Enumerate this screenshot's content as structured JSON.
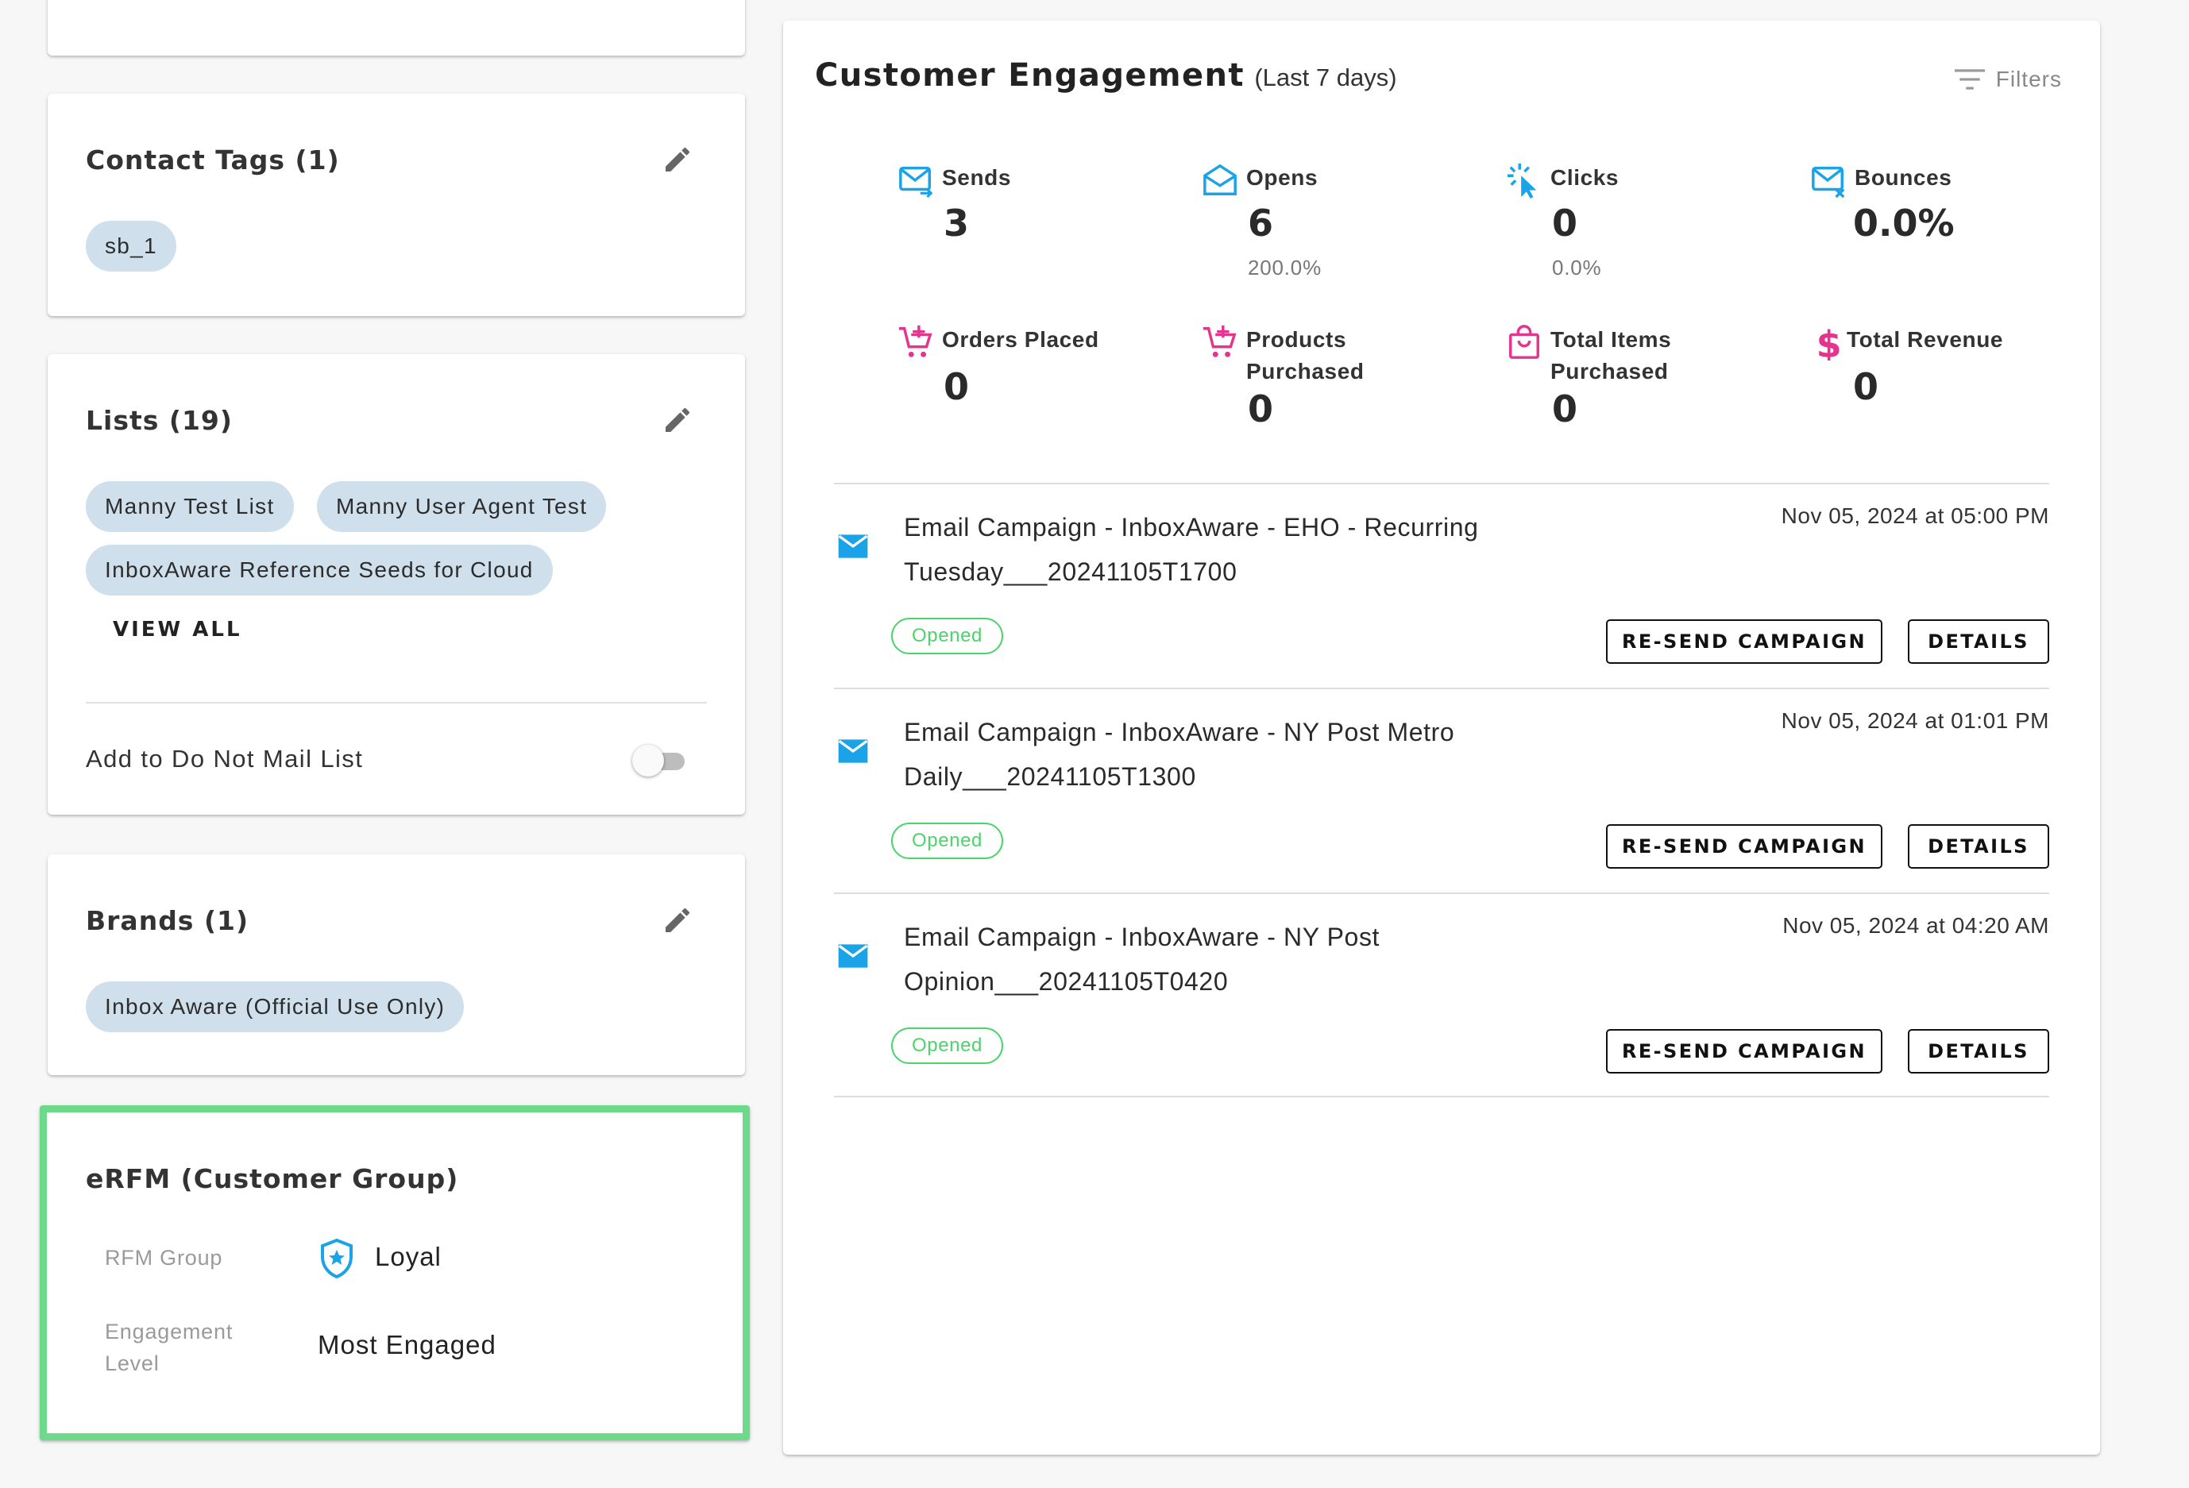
{
  "contact_tags": {
    "title": "Contact Tags (1)",
    "tags": [
      "sb_1"
    ]
  },
  "lists": {
    "title": "Lists (19)",
    "chips": [
      "Manny Test List",
      "Manny User Agent Test",
      "InboxAware Reference Seeds for Cloud"
    ],
    "view_all": "VIEW ALL",
    "do_not_mail_label": "Add to Do Not Mail List",
    "do_not_mail_on": false
  },
  "brands": {
    "title": "Brands (1)",
    "chips": [
      "Inbox Aware (Official Use Only)"
    ]
  },
  "erfm": {
    "title": "eRFM (Customer Group)",
    "rfm_group_label": "RFM Group",
    "rfm_group_value": "Loyal",
    "engagement_label": "Engagement Level",
    "engagement_value": "Most Engaged",
    "highlight_color": "#6dd98a"
  },
  "engagement": {
    "title": "Customer Engagement",
    "period": "(Last 7 days)",
    "filters_label": "Filters",
    "metrics": [
      {
        "label": "Sends",
        "value": "3",
        "pct": "",
        "icon": "mail-send-icon"
      },
      {
        "label": "Opens",
        "value": "6",
        "pct": "200.0%",
        "icon": "mail-open-icon"
      },
      {
        "label": "Clicks",
        "value": "0",
        "pct": "0.0%",
        "icon": "cursor-click-icon"
      },
      {
        "label": "Bounces",
        "value": "0.0%",
        "pct": "",
        "icon": "mail-bounce-icon"
      },
      {
        "label": "Orders Placed",
        "value": "0",
        "pct": "",
        "icon": "cart-add-icon"
      },
      {
        "label": "Products Purchased",
        "value": "0",
        "pct": "",
        "icon": "cart-add-icon"
      },
      {
        "label": "Total Items Purchased",
        "value": "0",
        "pct": "",
        "icon": "shopping-bag-icon"
      },
      {
        "label": "Total Revenue",
        "value": "0",
        "pct": "",
        "icon": "dollar-icon"
      }
    ],
    "campaigns": [
      {
        "name": "Email Campaign - InboxAware - EHO - Recurring Tuesday___20241105T1700",
        "date": "Nov 05, 2024 at 05:00 PM",
        "status": "Opened",
        "resend_label": "RE-SEND CAMPAIGN",
        "details_label": "DETAILS"
      },
      {
        "name": "Email Campaign - InboxAware - NY Post Metro Daily___20241105T1300",
        "date": "Nov 05, 2024 at 01:01 PM",
        "status": "Opened",
        "resend_label": "RE-SEND CAMPAIGN",
        "details_label": "DETAILS"
      },
      {
        "name": "Email Campaign - InboxAware - NY Post Opinion___20241105T0420",
        "date": "Nov 05, 2024 at 04:20 AM",
        "status": "Opened",
        "resend_label": "RE-SEND CAMPAIGN",
        "details_label": "DETAILS"
      }
    ],
    "colors": {
      "mail_icon": "#1aa3e8",
      "commerce_icon": "#e3348e",
      "opened_badge": "#4cd46b"
    }
  }
}
